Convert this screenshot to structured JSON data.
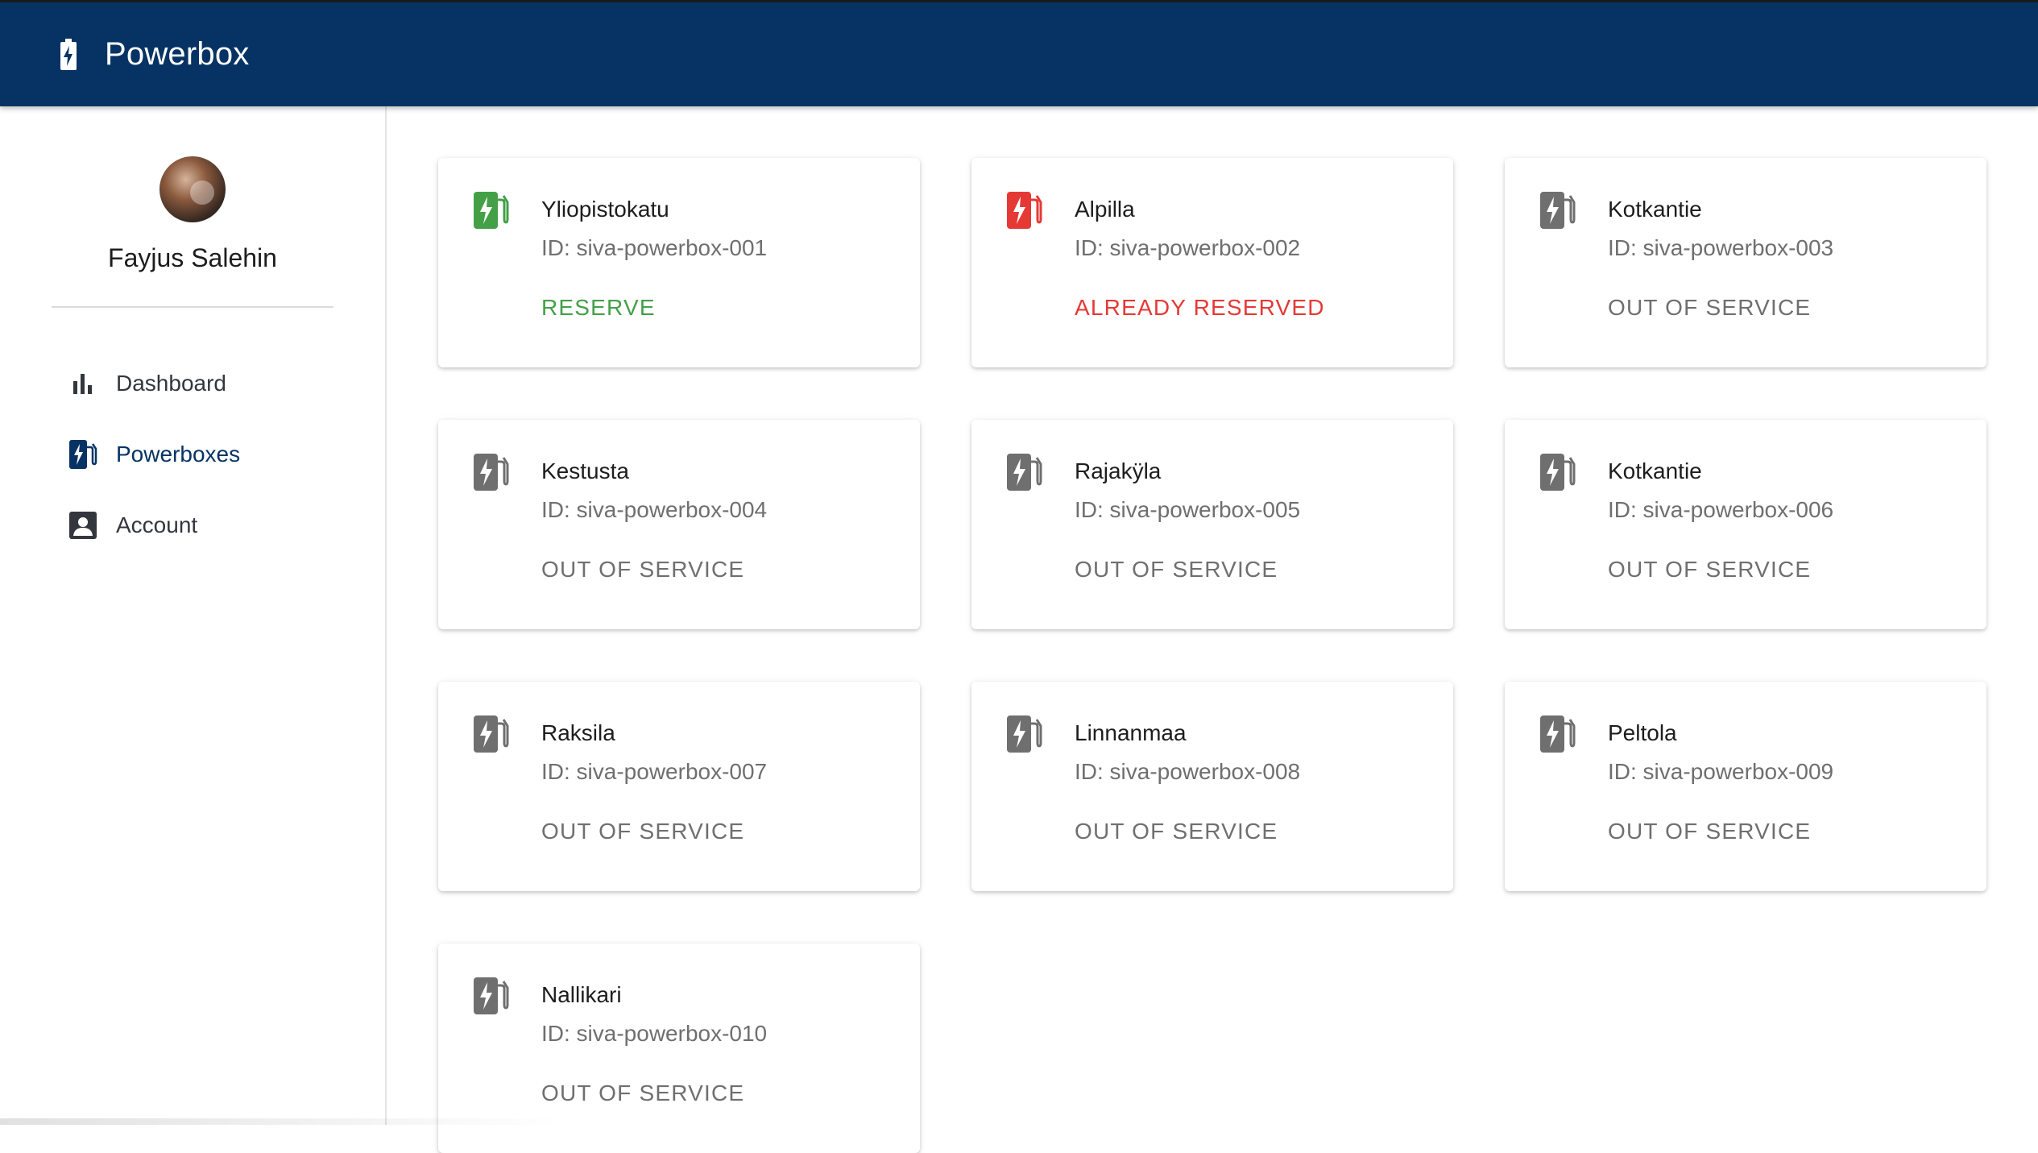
{
  "app": {
    "title": "Powerbox",
    "logo_icon": "battery-charging-icon",
    "header_color": "#063364"
  },
  "user": {
    "name": "Fayjus Salehin"
  },
  "nav": [
    {
      "label": "Dashboard",
      "icon": "bar-chart-icon",
      "active": false
    },
    {
      "label": "Powerboxes",
      "icon": "ev-station-icon",
      "active": true
    },
    {
      "label": "Account",
      "icon": "account-box-icon",
      "active": false
    }
  ],
  "status_colors": {
    "available": "#43a047",
    "reserved": "#e53935",
    "out_of_service": "#6f6f6f"
  },
  "powerboxes": [
    {
      "name": "Yliopistokatu",
      "id": "ID: siva-powerbox-001",
      "action": "RESERVE",
      "status": "available"
    },
    {
      "name": "Alpilla",
      "id": "ID: siva-powerbox-002",
      "action": "ALREADY RESERVED",
      "status": "reserved"
    },
    {
      "name": "Kotkantie",
      "id": "ID: siva-powerbox-003",
      "action": "OUT OF SERVICE",
      "status": "out_of_service"
    },
    {
      "name": "Kestusta",
      "id": "ID: siva-powerbox-004",
      "action": "OUT OF SERVICE",
      "status": "out_of_service"
    },
    {
      "name": "Rajakÿla",
      "id": "ID: siva-powerbox-005",
      "action": "OUT OF SERVICE",
      "status": "out_of_service"
    },
    {
      "name": "Kotkantie",
      "id": "ID: siva-powerbox-006",
      "action": "OUT OF SERVICE",
      "status": "out_of_service"
    },
    {
      "name": "Raksila",
      "id": "ID: siva-powerbox-007",
      "action": "OUT OF SERVICE",
      "status": "out_of_service"
    },
    {
      "name": "Linnanmaa",
      "id": "ID: siva-powerbox-008",
      "action": "OUT OF SERVICE",
      "status": "out_of_service"
    },
    {
      "name": "Peltola",
      "id": "ID: siva-powerbox-009",
      "action": "OUT OF SERVICE",
      "status": "out_of_service"
    },
    {
      "name": "Nallikari",
      "id": "ID: siva-powerbox-010",
      "action": "OUT OF SERVICE",
      "status": "out_of_service"
    }
  ]
}
